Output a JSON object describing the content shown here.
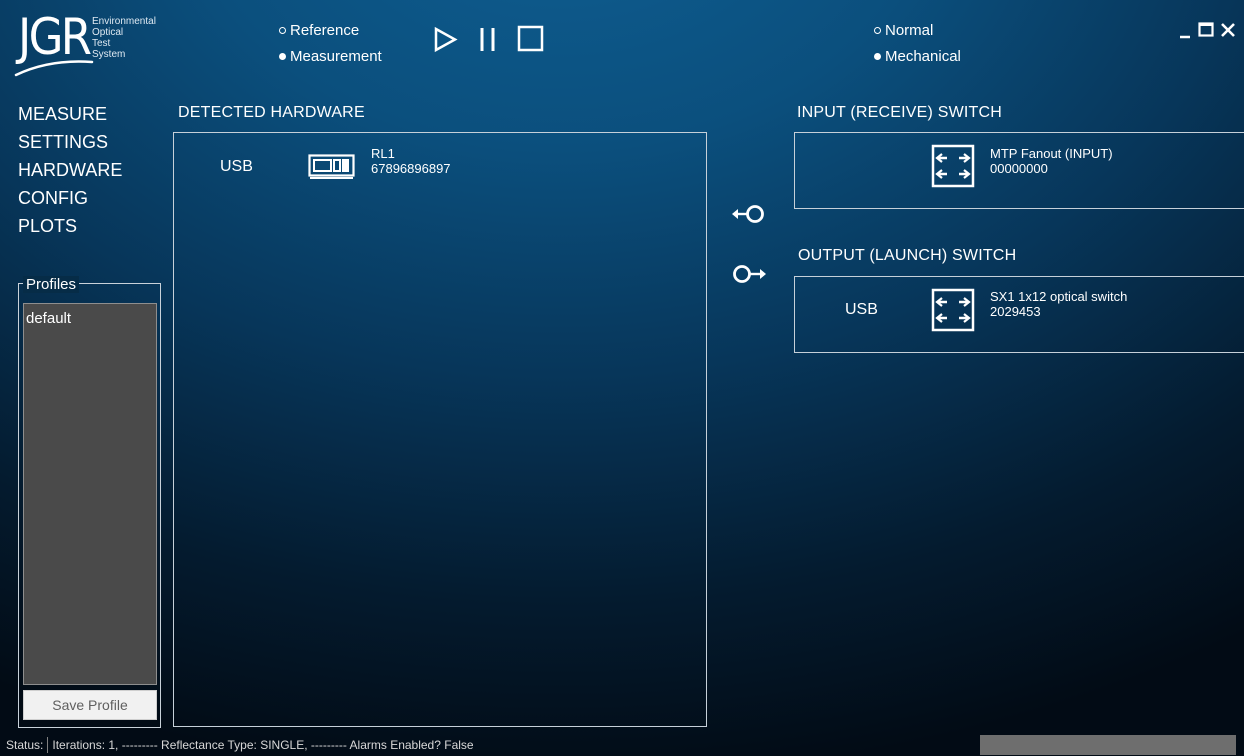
{
  "logo": {
    "brand": "JGR",
    "subtitle_lines": [
      "Environmental",
      "Optical",
      "Test",
      "System"
    ]
  },
  "mode": {
    "options": [
      {
        "label": "Reference",
        "selected": false
      },
      {
        "label": "Measurement",
        "selected": true
      }
    ]
  },
  "switch_mode": {
    "options": [
      {
        "label": "Normal",
        "selected": false
      },
      {
        "label": "Mechanical",
        "selected": true
      }
    ]
  },
  "nav": {
    "items": [
      "MEASURE",
      "SETTINGS",
      "HARDWARE",
      "CONFIG",
      "PLOTS"
    ]
  },
  "profiles": {
    "legend": "Profiles",
    "items": [
      "default"
    ],
    "save_label": "Save Profile"
  },
  "detected_hardware": {
    "title": "DETECTED HARDWARE",
    "devices": [
      {
        "interface": "USB",
        "name": "RL1",
        "serial": "67896896897",
        "icon": "instrument-icon"
      }
    ]
  },
  "input_switch": {
    "title": "INPUT (RECEIVE) SWITCH",
    "interface": "",
    "name": "MTP Fanout (INPUT)",
    "serial": "00000000",
    "icon": "switch-icon"
  },
  "output_switch": {
    "title": "OUTPUT (LAUNCH) SWITCH",
    "interface": "USB",
    "name": "SX1 1x12 optical switch",
    "serial": "2029453",
    "icon": "switch-icon"
  },
  "status": {
    "label": "Status:",
    "text": "Iterations: 1, --------- Reflectance Type: SINGLE, --------- Alarms Enabled? False"
  },
  "colors": {
    "background_top": "#0f5f93",
    "background_bottom": "#020b15",
    "profile_list_bg": "#4a4a4a",
    "progress_bar": "#6e6e6e"
  }
}
